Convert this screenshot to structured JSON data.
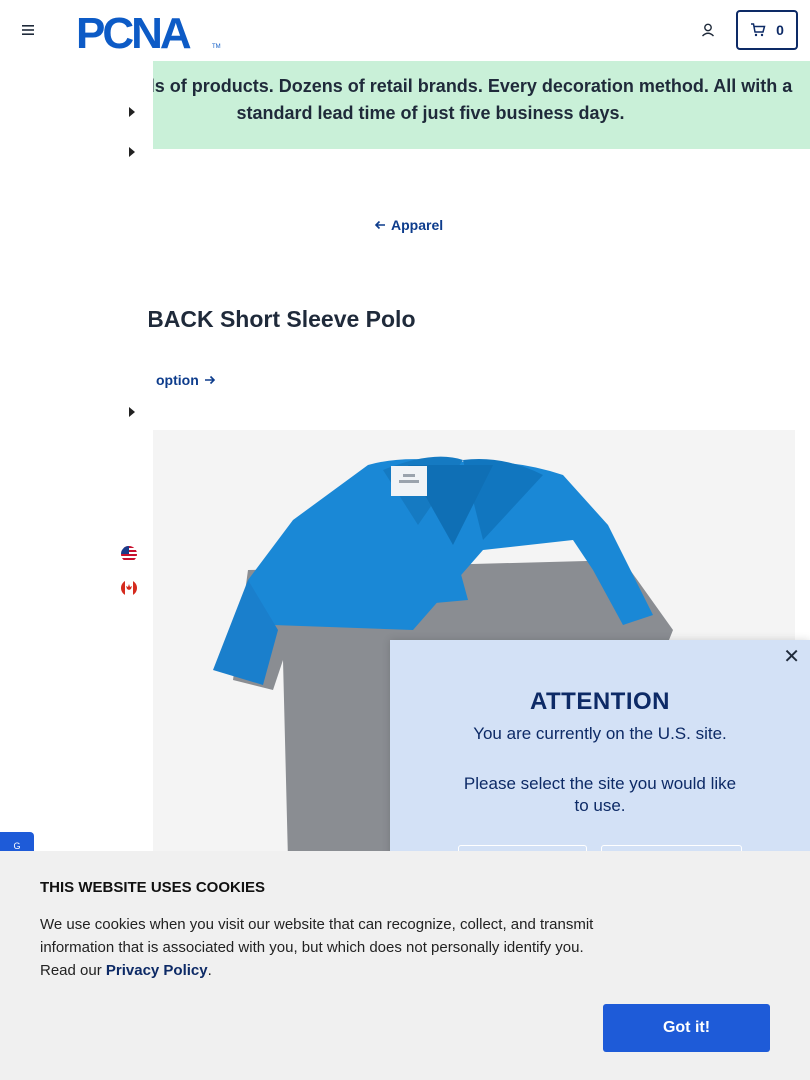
{
  "header": {
    "logo_text": "PCNA",
    "logo_tm": "TM",
    "cart_count": "0",
    "brand_color": "#0d2a66"
  },
  "promo": {
    "text": "Thousands of products. Dozens of retail brands. Every decoration method. All with a standard lead time of just five business days.",
    "background": "#c9f0d8"
  },
  "breadcrumb": {
    "back_label": "Apparel"
  },
  "product": {
    "title": "TAMBACK Short Sleeve Polo",
    "option_link": "option"
  },
  "side_tab": {
    "label": "G"
  },
  "modal": {
    "title": "ATTENTION",
    "message": "You are currently on the U.S. site.",
    "prompt": "Please select the site you would like to use.",
    "close_icon": "close-icon"
  },
  "cookies": {
    "title": "THIS WEBSITE USES COOKIES",
    "body": "We use cookies when you visit our website that can recognize, collect, and transmit information that is associated with you, but which does not personally identify you. Read our ",
    "link_label": "Privacy Policy",
    "body_end": ".",
    "button_label": "Got it!",
    "button_color": "#1e5bd8"
  }
}
